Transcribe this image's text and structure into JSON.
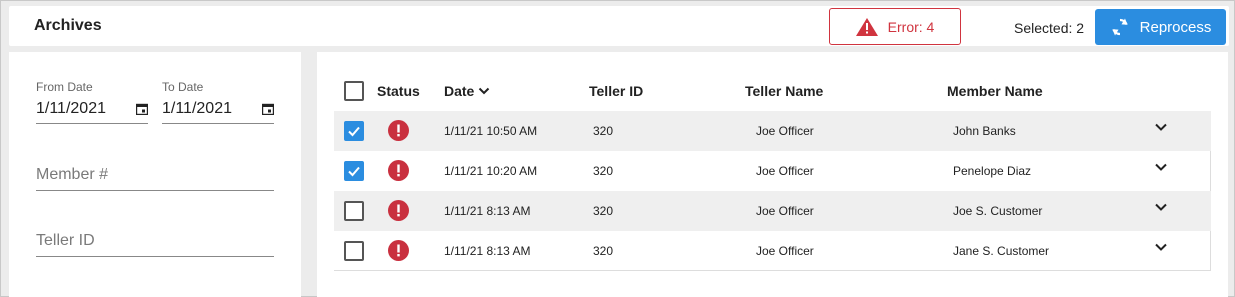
{
  "header": {
    "title": "Archives",
    "error_label": "Error: 4",
    "selected_label": "Selected: 2",
    "reprocess_label": "Reprocess"
  },
  "filters": {
    "from_date_label": "From Date",
    "from_date_value": "1/11/2021",
    "to_date_label": "To Date",
    "to_date_value": "1/11/2021",
    "member_placeholder": "Member #",
    "teller_placeholder": "Teller ID"
  },
  "table": {
    "columns": [
      "Status",
      "Date",
      "Teller ID",
      "Teller Name",
      "Member Name"
    ],
    "rows": [
      {
        "checked": true,
        "date": "1/11/21 10:50 AM",
        "teller_id": "320",
        "teller_name": "Joe Officer",
        "member_name": "John Banks"
      },
      {
        "checked": true,
        "date": "1/11/21 10:20 AM",
        "teller_id": "320",
        "teller_name": "Joe Officer",
        "member_name": "Penelope Diaz"
      },
      {
        "checked": false,
        "date": "1/11/21 8:13 AM",
        "teller_id": "320",
        "teller_name": "Joe Officer",
        "member_name": "Joe S. Customer"
      },
      {
        "checked": false,
        "date": "1/11/21 8:13 AM",
        "teller_id": "320",
        "teller_name": "Joe Officer",
        "member_name": "Jane S. Customer"
      }
    ]
  },
  "colors": {
    "accent": "#2b8de0",
    "error": "#d0343f",
    "status_error": "#c9303f"
  },
  "icons": {
    "error": "warning-triangle-icon",
    "reprocess": "refresh-icon",
    "date_picker": "calendar-icon",
    "sort": "chevron-down-icon",
    "row_status": "error-circle-icon",
    "row_expand": "chevron-down-icon"
  }
}
